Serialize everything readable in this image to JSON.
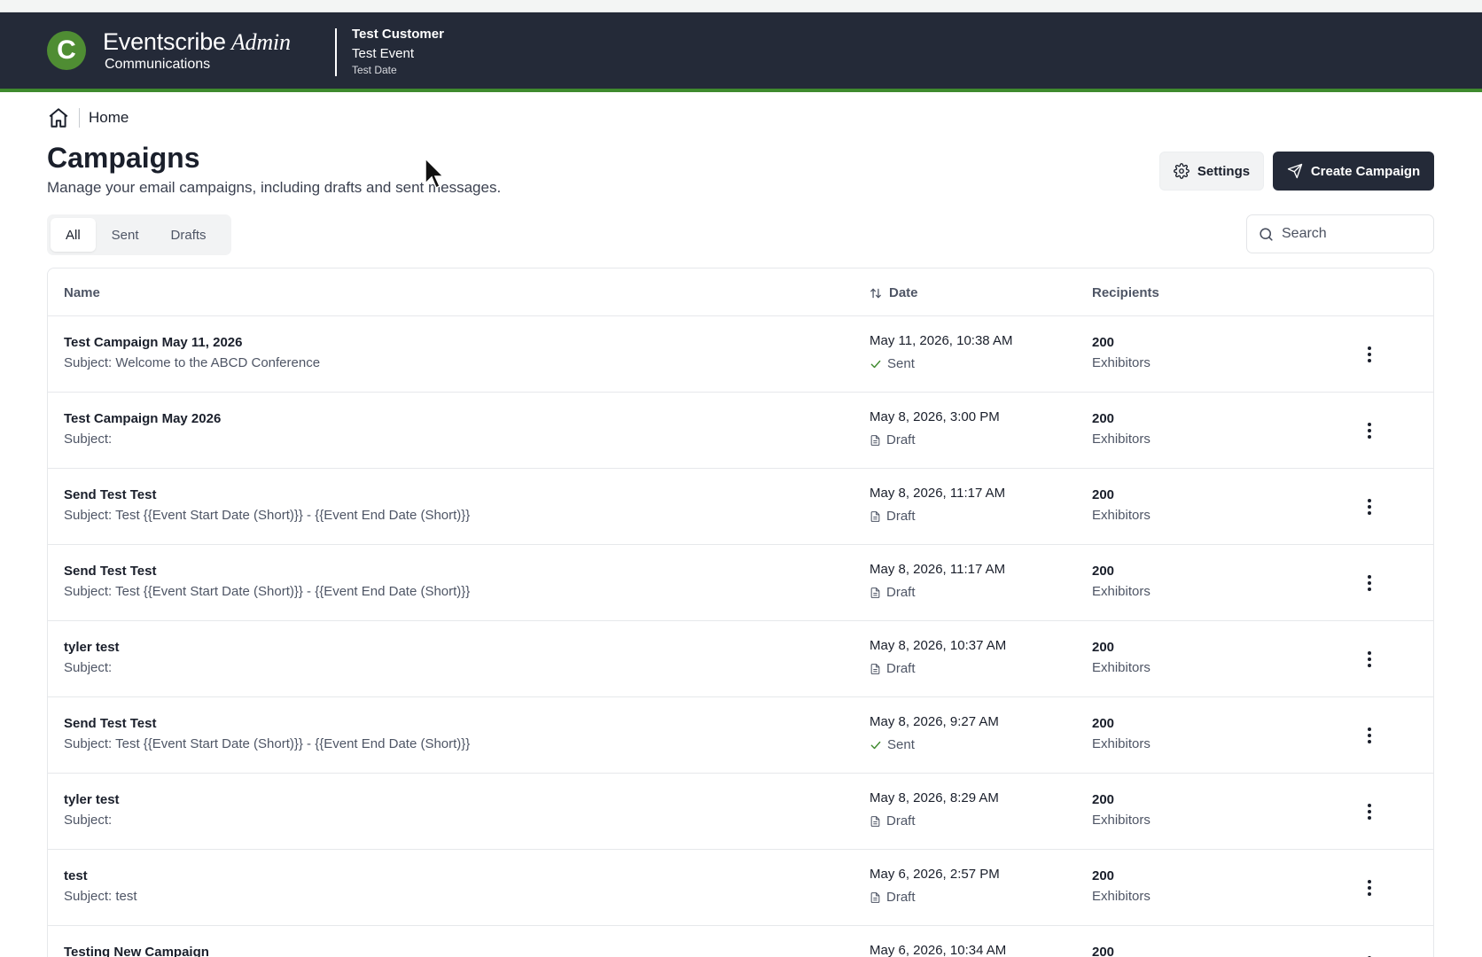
{
  "header": {
    "logo_letter": "C",
    "brand_name": "Eventscribe",
    "brand_admin": "Admin",
    "brand_sub": "Communications",
    "customer": "Test Customer",
    "event": "Test Event",
    "event_date": "Test Date",
    "accent_color": "#4f8d33",
    "bar_color": "#242a38"
  },
  "breadcrumb": {
    "icon": "home-icon",
    "label": "Home"
  },
  "page": {
    "title": "Campaigns",
    "subtitle": "Manage your email campaigns, including drafts and sent messages."
  },
  "actions": {
    "settings_label": "Settings",
    "settings_icon": "gear-icon",
    "create_label": "Create Campaign",
    "create_icon": "send-icon"
  },
  "tabs": [
    {
      "label": "All",
      "active": true
    },
    {
      "label": "Sent",
      "active": false
    },
    {
      "label": "Drafts",
      "active": false
    }
  ],
  "search": {
    "placeholder": "Search",
    "value": ""
  },
  "table": {
    "columns": {
      "name": "Name",
      "date": "Date",
      "recipients": "Recipients"
    },
    "rows": [
      {
        "name": "Test Campaign May 11, 2026",
        "subject": "Subject: Welcome to the ABCD Conference",
        "date": "May 11, 2026, 10:38 AM",
        "status": "Sent",
        "count": "200",
        "recipients": "Exhibitors"
      },
      {
        "name": "Test Campaign May 2026",
        "subject": "Subject:",
        "date": "May 8, 2026, 3:00 PM",
        "status": "Draft",
        "count": "200",
        "recipients": "Exhibitors"
      },
      {
        "name": "Send Test Test",
        "subject": "Subject: Test {{Event Start Date (Short)}} - {{Event End Date (Short)}}",
        "date": "May 8, 2026, 11:17 AM",
        "status": "Draft",
        "count": "200",
        "recipients": "Exhibitors"
      },
      {
        "name": "Send Test Test",
        "subject": "Subject: Test {{Event Start Date (Short)}} - {{Event End Date (Short)}}",
        "date": "May 8, 2026, 11:17 AM",
        "status": "Draft",
        "count": "200",
        "recipients": "Exhibitors"
      },
      {
        "name": "tyler test",
        "subject": "Subject:",
        "date": "May 8, 2026, 10:37 AM",
        "status": "Draft",
        "count": "200",
        "recipients": "Exhibitors"
      },
      {
        "name": "Send Test Test",
        "subject": "Subject: Test {{Event Start Date (Short)}} - {{Event End Date (Short)}}",
        "date": "May 8, 2026, 9:27 AM",
        "status": "Sent",
        "count": "200",
        "recipients": "Exhibitors"
      },
      {
        "name": "tyler test",
        "subject": "Subject:",
        "date": "May 8, 2026, 8:29 AM",
        "status": "Draft",
        "count": "200",
        "recipients": "Exhibitors"
      },
      {
        "name": "test",
        "subject": "Subject: test",
        "date": "May 6, 2026, 2:57 PM",
        "status": "Draft",
        "count": "200",
        "recipients": "Exhibitors"
      },
      {
        "name": "Testing New Campaign",
        "subject": "",
        "date": "May 6, 2026, 10:34 AM",
        "status": "",
        "count": "200",
        "recipients": ""
      }
    ]
  }
}
